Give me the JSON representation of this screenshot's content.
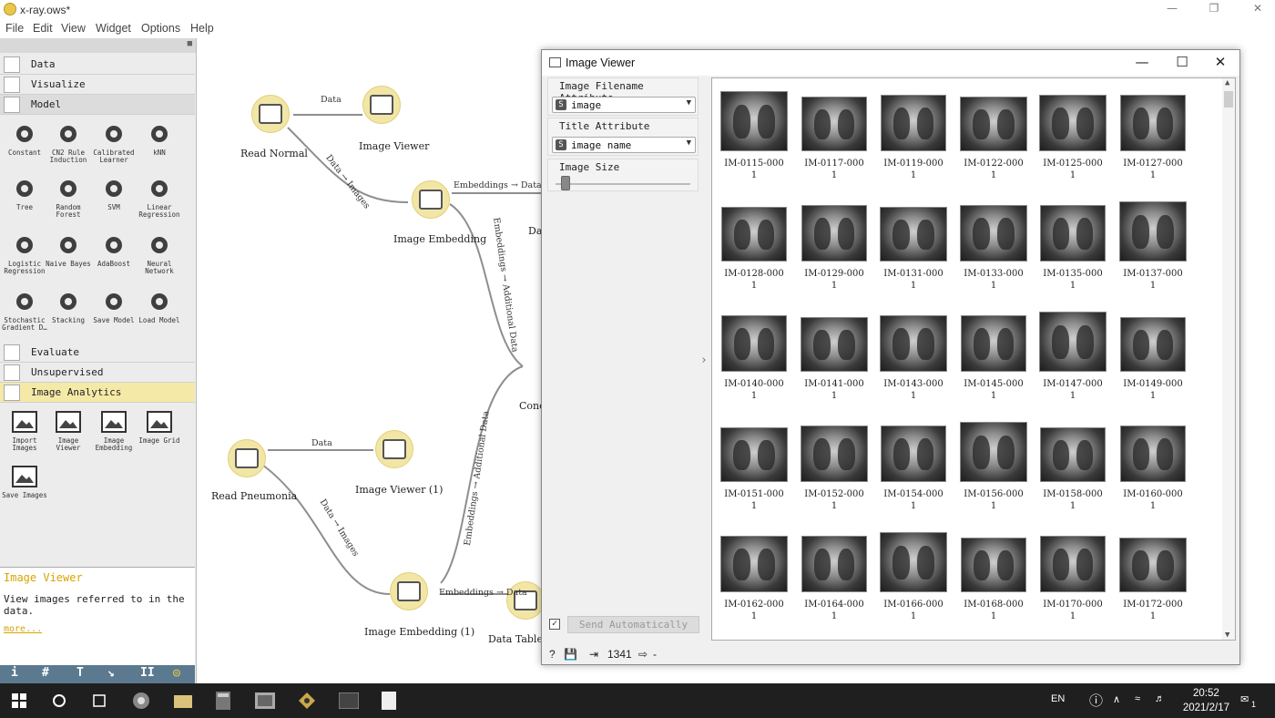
{
  "window": {
    "title": "x-ray.ows*"
  },
  "menu": [
    "File",
    "Edit",
    "View",
    "Widget",
    "Options",
    "Help"
  ],
  "panel": {
    "categories": {
      "data": "Data",
      "visualize": "Visualize",
      "model": "Model",
      "evaluate": "Evaluate",
      "unsupervised": "Unsupervised",
      "image_analytics": "Image Analytics"
    },
    "model_widgets": [
      "Constant",
      "CN2 Rule Induction",
      "Calibrated Learner",
      "kNN",
      "Tree",
      "Random Forest",
      "SVM",
      "Linear Regression",
      "Logistic Regression",
      "Naive Bayes",
      "AdaBoost",
      "Neural Network",
      "Stochastic Gradient D…",
      "Stacking",
      "Save Model",
      "Load Model"
    ],
    "image_widgets": [
      "Import Images",
      "Image Viewer",
      "Image Embedding",
      "Image Grid",
      "Save Images"
    ],
    "description": {
      "title": "Image Viewer",
      "text": "View images referred to in the data.",
      "more": "more..."
    },
    "toolstrip": [
      "i",
      "#",
      "T",
      "↘",
      "II",
      "◎"
    ]
  },
  "canvas": {
    "nodes": {
      "read_normal": "Read Normal",
      "image_viewer": "Image Viewer",
      "image_embedding": "Image Embedding",
      "data_partial": "Da",
      "concat_partial": "Conc",
      "read_pneumonia": "Read Pneumonia",
      "image_viewer_1": "Image Viewer (1)",
      "image_embedding_1": "Image Embedding (1)",
      "data_table": "Data Table"
    },
    "edges": {
      "e1": "Data",
      "e2": "Data → Images",
      "e3": "Embeddings → Data",
      "e4": "Embeddings → Additional Data",
      "e5": "Data",
      "e6": "Data → Images",
      "e7": "Embeddings → Additional Data",
      "e8": "Embeddings → Data"
    }
  },
  "dialog": {
    "title": "Image Viewer",
    "filename_attr_label": "Image Filename Attribute",
    "filename_attr_value": "image",
    "title_attr_label": "Title Attribute",
    "title_attr_value": "image name",
    "image_size_label": "Image Size",
    "image_size_level": 0.05,
    "string_badge": "S",
    "auto_send_label": "Send Automatically",
    "auto_send_checked": "✓",
    "status_count": "1341",
    "status_out": "-",
    "images": [
      "IM-0115-0001",
      "IM-0117-0001",
      "IM-0119-0001",
      "IM-0122-0001",
      "IM-0125-0001",
      "IM-0127-0001",
      "IM-0128-0001",
      "IM-0129-0001",
      "IM-0131-0001",
      "IM-0133-0001",
      "IM-0135-0001",
      "IM-0137-0001",
      "IM-0140-0001",
      "IM-0141-0001",
      "IM-0143-0001",
      "IM-0145-0001",
      "IM-0147-0001",
      "IM-0149-0001",
      "IM-0151-0001",
      "IM-0152-0001",
      "IM-0154-0001",
      "IM-0156-0001",
      "IM-0158-0001",
      "IM-0160-0001",
      "IM-0162-0001",
      "IM-0164-0001",
      "IM-0166-0001",
      "IM-0168-0001",
      "IM-0170-0001",
      "IM-0172-0001"
    ]
  },
  "taskbar": {
    "lang": "EN",
    "time": "20:52",
    "date": "2021/2/17",
    "notifications": "1"
  }
}
